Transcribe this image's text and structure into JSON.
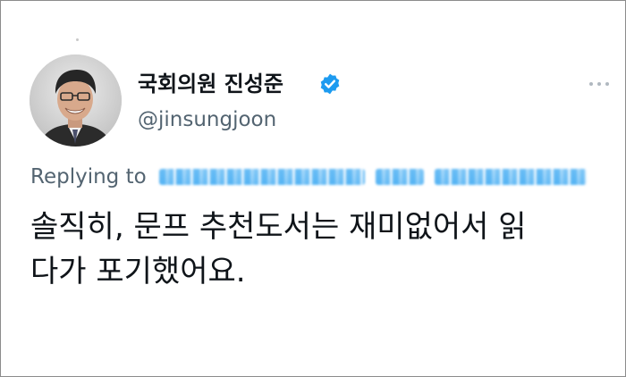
{
  "tweet": {
    "author": {
      "display_name": "국회의원 진성준",
      "handle": "@jinsungjoon",
      "verified": true
    },
    "reply_prefix": "Replying to",
    "text_lines": [
      "솔직히, 문프 추천도서는 재미없어서 읽",
      "다가 포기했어요."
    ]
  },
  "colors": {
    "name": "#0f1419",
    "secondary": "#536471",
    "verified_badge": "#1d9bf0"
  },
  "icons": {
    "verified": "verified-badge-icon",
    "more": "more-options-icon"
  }
}
